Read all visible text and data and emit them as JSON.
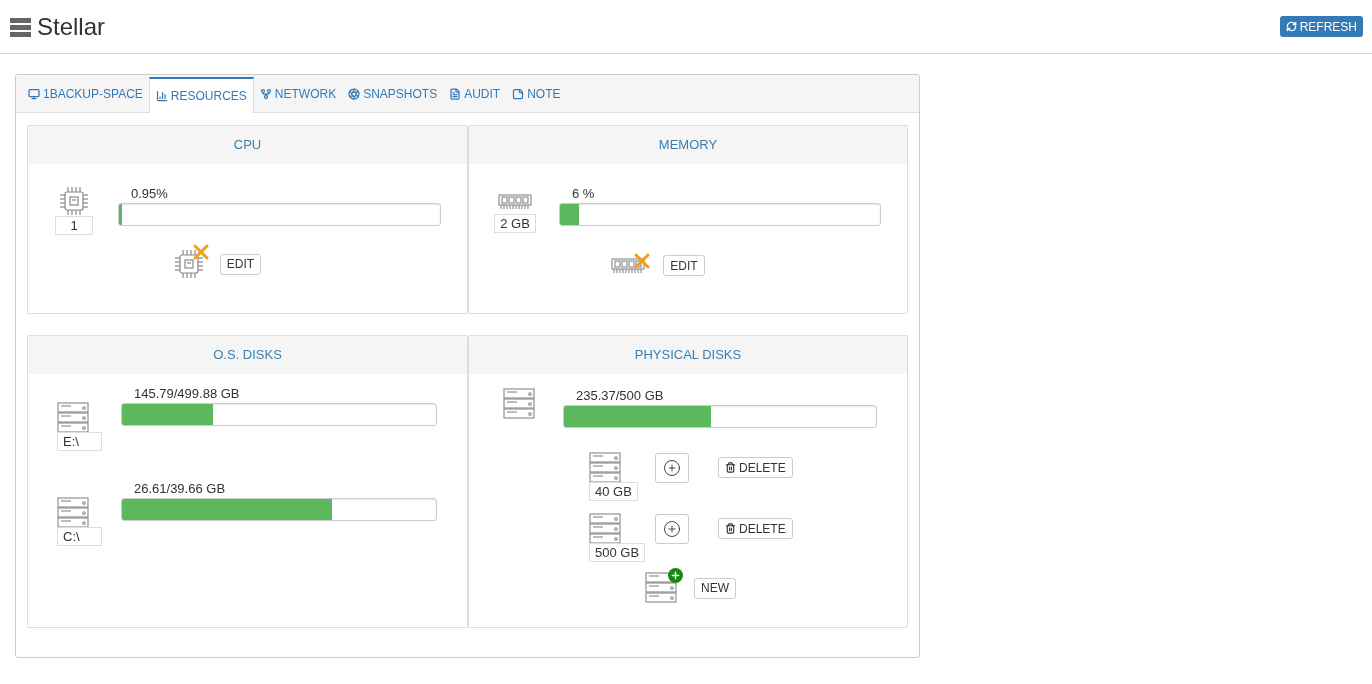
{
  "header": {
    "title": "Stellar",
    "refresh_button": "REFRESH"
  },
  "tabs": [
    {
      "label": "1BACKUP-SPACE",
      "kind": "monitor",
      "selected": false
    },
    {
      "label": "RESOURCES",
      "kind": "chart",
      "selected": true
    },
    {
      "label": "NETWORK",
      "kind": "fork",
      "selected": false
    },
    {
      "label": "SNAPSHOTS",
      "kind": "aperture",
      "selected": false
    },
    {
      "label": "AUDIT",
      "kind": "list",
      "selected": false
    },
    {
      "label": "NOTE",
      "kind": "note",
      "selected": false
    }
  ],
  "cpu": {
    "title": "CPU",
    "count": "1",
    "reading": "0.95%",
    "level": 0.0095,
    "edit_button": "EDIT"
  },
  "memory": {
    "title": "MEMORY",
    "size": "2 GB",
    "reading": "6 %",
    "level": 0.06,
    "edit_button": "EDIT"
  },
  "os_disks": {
    "title": "O.S. DISKS",
    "disks": [
      {
        "label": "E:\\",
        "reading": "145.79/499.88 GB",
        "level": 0.29
      },
      {
        "label": "C:\\",
        "reading": "26.61/39.66 GB",
        "level": 0.67
      }
    ]
  },
  "physical_disks": {
    "title": "PHYSICAL DISKS",
    "reading": "235.37/500 GB",
    "level": 0.47,
    "disks": [
      {
        "size": "40 GB",
        "delete_button": "DELETE"
      },
      {
        "size": "500 GB",
        "delete_button": "DELETE"
      }
    ],
    "new_button": "NEW"
  }
}
